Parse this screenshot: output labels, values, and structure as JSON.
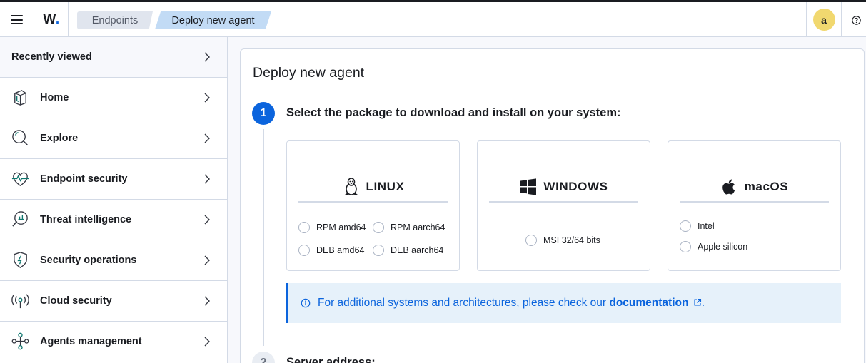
{
  "header": {
    "logo_text": "W",
    "logo_dot": ".",
    "breadcrumbs": [
      {
        "label": "Endpoints"
      },
      {
        "label": "Deploy new agent"
      }
    ],
    "user_initial": "a"
  },
  "sidebar": {
    "recent_label": "Recently viewed",
    "items": [
      {
        "label": "Home",
        "icon": "home-icon"
      },
      {
        "label": "Explore",
        "icon": "search-icon"
      },
      {
        "label": "Endpoint security",
        "icon": "heartbeat-icon"
      },
      {
        "label": "Threat intelligence",
        "icon": "threat-intelligence-icon"
      },
      {
        "label": "Security operations",
        "icon": "shield-icon"
      },
      {
        "label": "Cloud security",
        "icon": "broadcast-icon"
      },
      {
        "label": "Agents management",
        "icon": "network-icon"
      }
    ]
  },
  "main": {
    "title": "Deploy new agent",
    "step1": {
      "number": "1",
      "title": "Select the package to download and install on your system:"
    },
    "os_cards": [
      {
        "name": "LINUX",
        "icon": "linux-icon",
        "options": [
          "RPM amd64",
          "RPM aarch64",
          "DEB amd64",
          "DEB aarch64"
        ]
      },
      {
        "name": "WINDOWS",
        "icon": "windows-icon",
        "options": [
          "MSI 32/64 bits"
        ]
      },
      {
        "name": "macOS",
        "icon": "apple-icon",
        "options": [
          "Intel",
          "Apple silicon"
        ]
      }
    ],
    "callout": {
      "text": "For additional systems and architectures, please check our",
      "link": "documentation",
      "suffix": "."
    },
    "step2": {
      "number": "2",
      "title": "Server address:"
    }
  },
  "colors": {
    "accent": "#0b64dd",
    "breadcrumb_active": "#c2dbf5",
    "avatar": "#f1d86f",
    "sidebar_icon": "#0f766e"
  }
}
